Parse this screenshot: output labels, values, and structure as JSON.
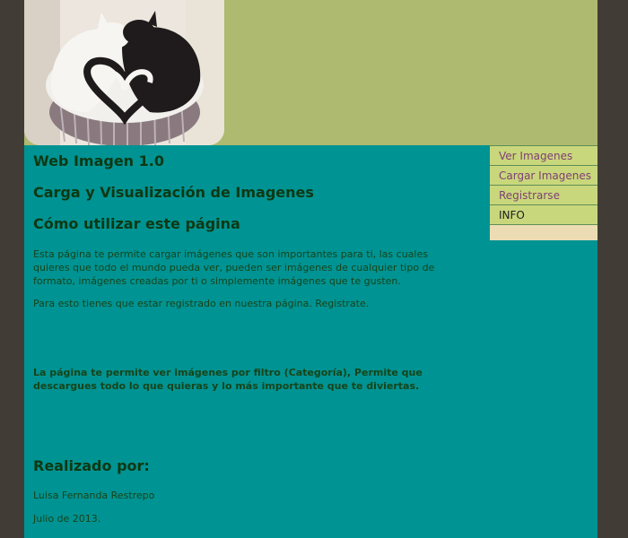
{
  "header": {
    "photo": "cats-yin-yang-photo"
  },
  "nav": {
    "items": [
      {
        "label": "Ver Imagenes"
      },
      {
        "label": "Cargar Imagenes"
      },
      {
        "label": "Registrarse"
      },
      {
        "label": "INFO"
      }
    ]
  },
  "main": {
    "title": "Web Imagen 1.0",
    "subtitle": "Carga y Visualización de Imagenes",
    "how_heading": "Cómo utilizar este página",
    "paragraph1": "Esta página te permite cargar imágenes que son importantes para ti, las cuales quieres que todo el mundo pueda ver, pueden ser imágenes de cualquier tipo de formato, imágenes creadas por ti o simplemente imágenes que te gusten.",
    "paragraph2": "Para esto tienes que estar registrado en nuestra página. Registrate.",
    "paragraph3": "La página te permite ver imágenes por filtro (Categoría), Permite que descargues todo lo que quieras y lo más importante que te diviertas.",
    "made_heading": "Realizado por:",
    "author": "Luisa Fernanda Restrepo",
    "date": "Julio de 2013."
  },
  "colors": {
    "page_bg": "#009393",
    "header_bg": "#adba6f",
    "nav_bg": "#c9d77c",
    "nav_link": "#7e3f74",
    "outer_bg": "#413d36"
  }
}
